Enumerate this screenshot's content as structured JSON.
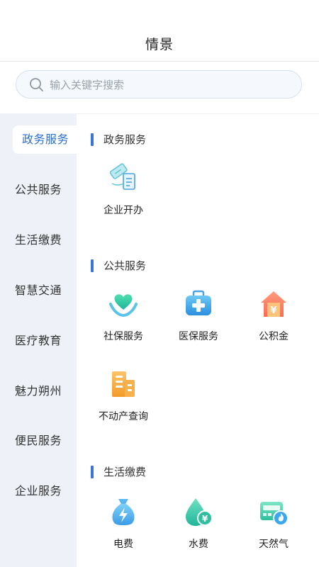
{
  "header": {
    "title": "情景"
  },
  "search": {
    "placeholder": "输入关键字搜索"
  },
  "sidebar": {
    "items": [
      {
        "label": "政务服务",
        "active": true
      },
      {
        "label": "公共服务"
      },
      {
        "label": "生活缴费"
      },
      {
        "label": "智慧交通"
      },
      {
        "label": "医疗教育"
      },
      {
        "label": "魅力朔州"
      },
      {
        "label": "便民服务"
      },
      {
        "label": "企业服务"
      }
    ]
  },
  "sections": [
    {
      "title": "政务服务",
      "tiles": [
        {
          "label": "企业开办",
          "icon": "business-license-icon"
        }
      ]
    },
    {
      "title": "公共服务",
      "tiles": [
        {
          "label": "社保服务",
          "icon": "heart-hands-icon"
        },
        {
          "label": "医保服务",
          "icon": "medical-kit-icon"
        },
        {
          "label": "公积金",
          "icon": "house-yuan-icon"
        },
        {
          "label": "不动产查询",
          "icon": "building-icon"
        }
      ]
    },
    {
      "title": "生活缴费",
      "tiles": [
        {
          "label": "电费",
          "icon": "electricity-bag-icon"
        },
        {
          "label": "水费",
          "icon": "water-drop-yuan-icon"
        },
        {
          "label": "天然气",
          "icon": "gas-meter-flame-icon"
        }
      ]
    }
  ],
  "colors": {
    "accent": "#3a74d4",
    "active_text": "#2b6fce",
    "sidebar_bg": "#eef2f8"
  }
}
